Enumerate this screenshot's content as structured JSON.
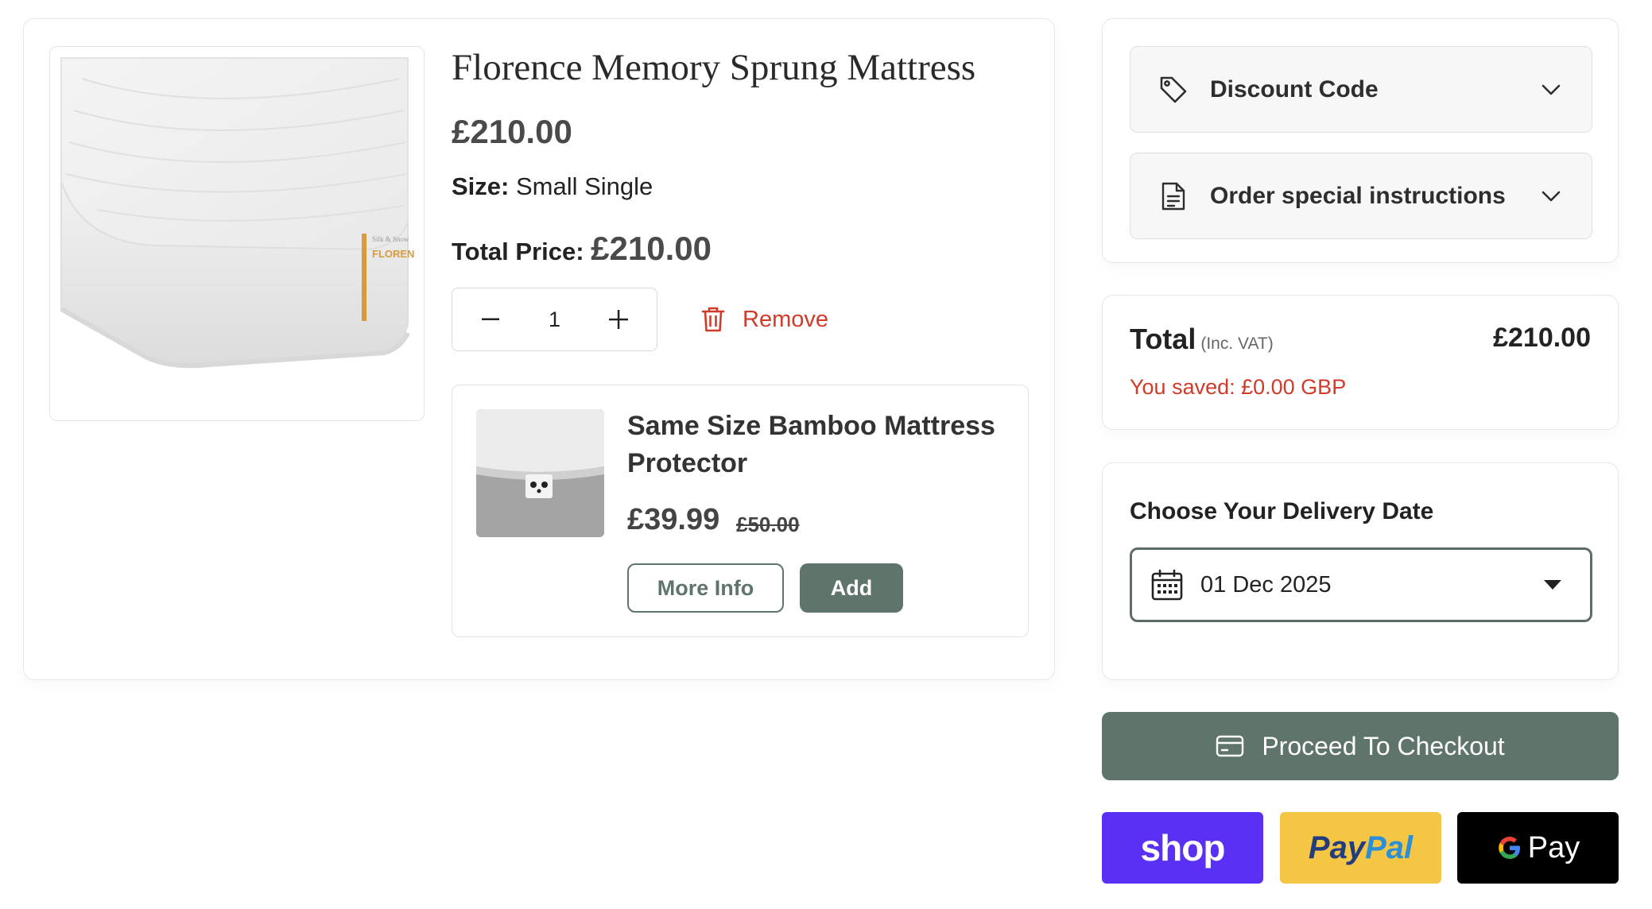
{
  "cart_item": {
    "title": "Florence Memory Sprung Mattress",
    "price": "£210.00",
    "size_label": "Size:",
    "size_value": "Small Single",
    "total_price_label": "Total Price:",
    "total_price_value": "£210.00",
    "quantity": "1",
    "remove_label": "Remove",
    "image_brand_text": "FLOREN",
    "image_brand_small": "Silk & Snow"
  },
  "upsell": {
    "title": "Same Size Bamboo Mattress Protector",
    "price": "£39.99",
    "compare_price": "£50.00",
    "more_info_label": "More Info",
    "add_label": "Add"
  },
  "extras": {
    "discount_label": "Discount Code",
    "instructions_label": "Order special instructions"
  },
  "summary": {
    "total_label": "Total",
    "vat_note": "(Inc. VAT)",
    "total_value": "£210.00",
    "saved_text": "You saved: £0.00 GBP"
  },
  "delivery": {
    "heading": "Choose Your Delivery Date",
    "selected_date": "01 Dec 2025"
  },
  "checkout": {
    "label": "Proceed To Checkout"
  },
  "payments": {
    "shop_label": "shop",
    "paypal_part1": "Pay",
    "paypal_part2": "Pal",
    "gpay_label": "Pay"
  },
  "colors": {
    "accent": "#5f756c",
    "danger": "#d23a2a",
    "shop_pay": "#5a31f4",
    "paypal": "#f5c544"
  }
}
